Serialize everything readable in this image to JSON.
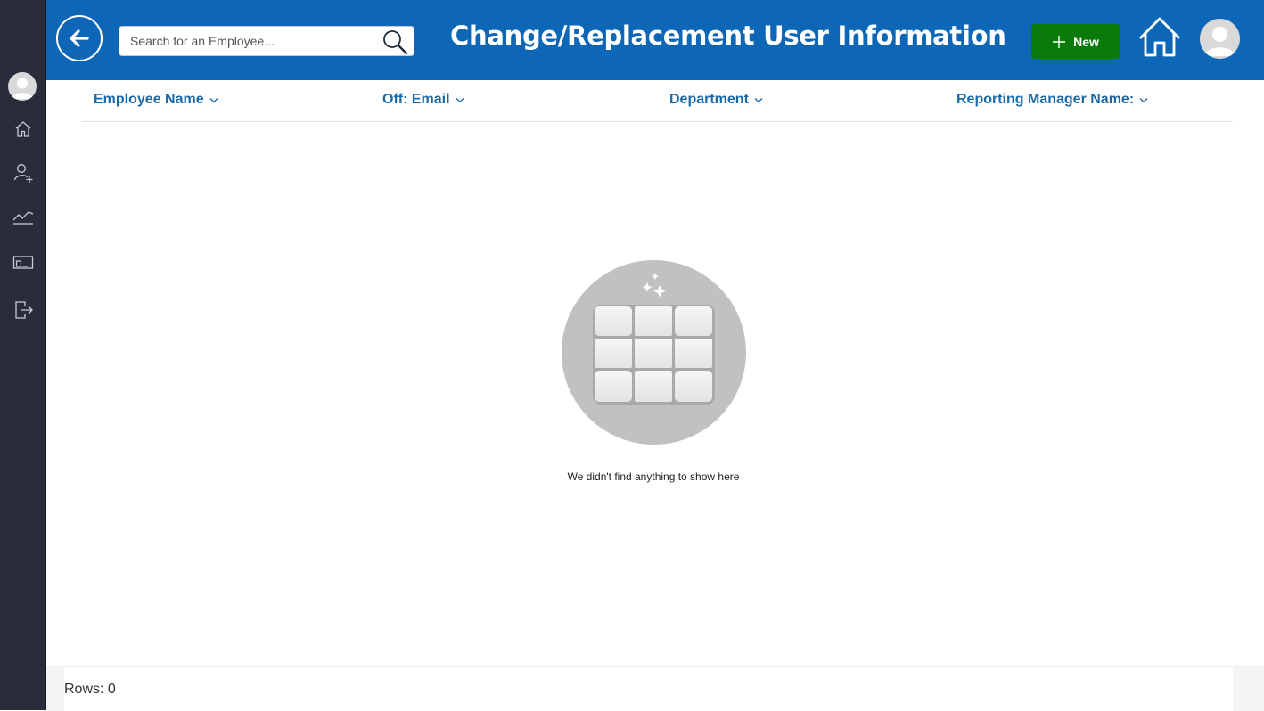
{
  "header": {
    "title": "Change/Replacement User Information",
    "search_placeholder": "Search for an Employee...",
    "new_button_label": "New"
  },
  "colors": {
    "header_bg": "#0e66b6",
    "rail_bg": "#292d3a",
    "new_button_bg": "#0a7a0a",
    "column_header_text": "#1b6aa8"
  },
  "sidebar": {
    "items": [
      {
        "icon": "home-icon"
      },
      {
        "icon": "add-user-icon"
      },
      {
        "icon": "trend-chart-icon"
      },
      {
        "icon": "display-icon"
      },
      {
        "icon": "sign-out-icon"
      }
    ]
  },
  "table": {
    "columns": [
      {
        "label": "Employee Name"
      },
      {
        "label": "Off: Email"
      },
      {
        "label": "Department"
      },
      {
        "label": "Reporting Manager Name:"
      }
    ],
    "empty_message": "We didn't find anything to show here"
  },
  "footer": {
    "rows_label": "Rows: 0"
  }
}
